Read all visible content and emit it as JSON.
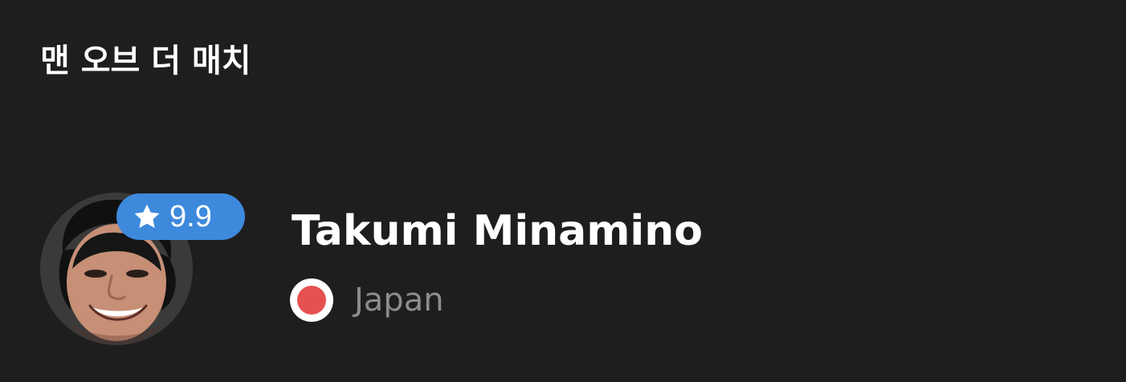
{
  "section": {
    "title": "맨 오브 더 매치"
  },
  "player": {
    "name": "Takumi Minamino",
    "rating": "9.9",
    "country": "Japan",
    "rating_icon": "star-icon",
    "flag_icon": "japan-flag-icon",
    "avatar": "player-photo"
  },
  "colors": {
    "background": "#1e1e1e",
    "rating_badge": "#3d89dc",
    "name_text": "#ffffff",
    "country_text": "#8d8d8d",
    "flag_red": "#e65150",
    "flag_white": "#ffffff"
  }
}
